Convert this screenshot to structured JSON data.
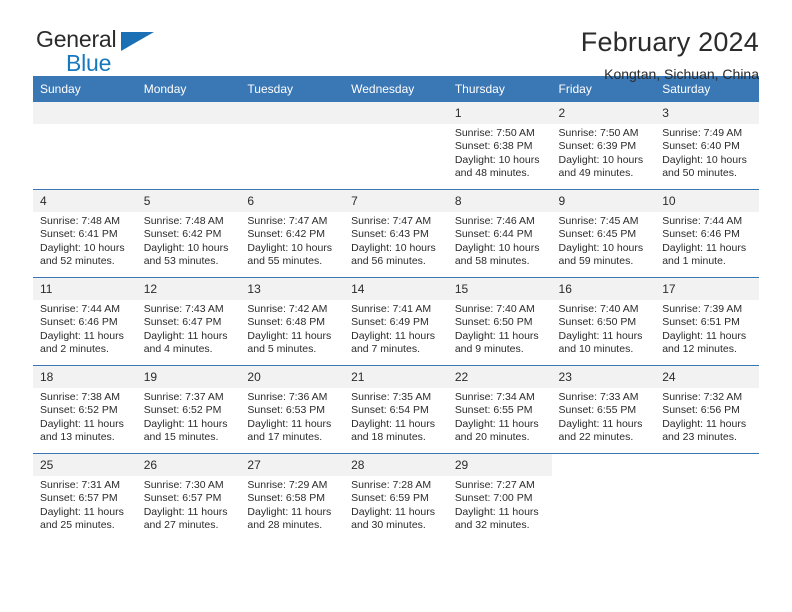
{
  "brand": {
    "name_part1": "General",
    "name_part2": "Blue",
    "accent_color": "#1a6fb5"
  },
  "header": {
    "title": "February 2024",
    "location": "Kongtan, Sichuan, China"
  },
  "calendar": {
    "header_color": "#3a77b5",
    "daynum_band_color": "#f2f2f2",
    "weekday_names": [
      "Sunday",
      "Monday",
      "Tuesday",
      "Wednesday",
      "Thursday",
      "Friday",
      "Saturday"
    ],
    "weeks": [
      [
        {
          "day": "",
          "sunrise": "",
          "sunset": "",
          "daylight_1": "",
          "daylight_2": ""
        },
        {
          "day": "",
          "sunrise": "",
          "sunset": "",
          "daylight_1": "",
          "daylight_2": ""
        },
        {
          "day": "",
          "sunrise": "",
          "sunset": "",
          "daylight_1": "",
          "daylight_2": ""
        },
        {
          "day": "",
          "sunrise": "",
          "sunset": "",
          "daylight_1": "",
          "daylight_2": ""
        },
        {
          "day": "1",
          "sunrise": "Sunrise: 7:50 AM",
          "sunset": "Sunset: 6:38 PM",
          "daylight_1": "Daylight: 10 hours",
          "daylight_2": "and 48 minutes."
        },
        {
          "day": "2",
          "sunrise": "Sunrise: 7:50 AM",
          "sunset": "Sunset: 6:39 PM",
          "daylight_1": "Daylight: 10 hours",
          "daylight_2": "and 49 minutes."
        },
        {
          "day": "3",
          "sunrise": "Sunrise: 7:49 AM",
          "sunset": "Sunset: 6:40 PM",
          "daylight_1": "Daylight: 10 hours",
          "daylight_2": "and 50 minutes."
        }
      ],
      [
        {
          "day": "4",
          "sunrise": "Sunrise: 7:48 AM",
          "sunset": "Sunset: 6:41 PM",
          "daylight_1": "Daylight: 10 hours",
          "daylight_2": "and 52 minutes."
        },
        {
          "day": "5",
          "sunrise": "Sunrise: 7:48 AM",
          "sunset": "Sunset: 6:42 PM",
          "daylight_1": "Daylight: 10 hours",
          "daylight_2": "and 53 minutes."
        },
        {
          "day": "6",
          "sunrise": "Sunrise: 7:47 AM",
          "sunset": "Sunset: 6:42 PM",
          "daylight_1": "Daylight: 10 hours",
          "daylight_2": "and 55 minutes."
        },
        {
          "day": "7",
          "sunrise": "Sunrise: 7:47 AM",
          "sunset": "Sunset: 6:43 PM",
          "daylight_1": "Daylight: 10 hours",
          "daylight_2": "and 56 minutes."
        },
        {
          "day": "8",
          "sunrise": "Sunrise: 7:46 AM",
          "sunset": "Sunset: 6:44 PM",
          "daylight_1": "Daylight: 10 hours",
          "daylight_2": "and 58 minutes."
        },
        {
          "day": "9",
          "sunrise": "Sunrise: 7:45 AM",
          "sunset": "Sunset: 6:45 PM",
          "daylight_1": "Daylight: 10 hours",
          "daylight_2": "and 59 minutes."
        },
        {
          "day": "10",
          "sunrise": "Sunrise: 7:44 AM",
          "sunset": "Sunset: 6:46 PM",
          "daylight_1": "Daylight: 11 hours",
          "daylight_2": "and 1 minute."
        }
      ],
      [
        {
          "day": "11",
          "sunrise": "Sunrise: 7:44 AM",
          "sunset": "Sunset: 6:46 PM",
          "daylight_1": "Daylight: 11 hours",
          "daylight_2": "and 2 minutes."
        },
        {
          "day": "12",
          "sunrise": "Sunrise: 7:43 AM",
          "sunset": "Sunset: 6:47 PM",
          "daylight_1": "Daylight: 11 hours",
          "daylight_2": "and 4 minutes."
        },
        {
          "day": "13",
          "sunrise": "Sunrise: 7:42 AM",
          "sunset": "Sunset: 6:48 PM",
          "daylight_1": "Daylight: 11 hours",
          "daylight_2": "and 5 minutes."
        },
        {
          "day": "14",
          "sunrise": "Sunrise: 7:41 AM",
          "sunset": "Sunset: 6:49 PM",
          "daylight_1": "Daylight: 11 hours",
          "daylight_2": "and 7 minutes."
        },
        {
          "day": "15",
          "sunrise": "Sunrise: 7:40 AM",
          "sunset": "Sunset: 6:50 PM",
          "daylight_1": "Daylight: 11 hours",
          "daylight_2": "and 9 minutes."
        },
        {
          "day": "16",
          "sunrise": "Sunrise: 7:40 AM",
          "sunset": "Sunset: 6:50 PM",
          "daylight_1": "Daylight: 11 hours",
          "daylight_2": "and 10 minutes."
        },
        {
          "day": "17",
          "sunrise": "Sunrise: 7:39 AM",
          "sunset": "Sunset: 6:51 PM",
          "daylight_1": "Daylight: 11 hours",
          "daylight_2": "and 12 minutes."
        }
      ],
      [
        {
          "day": "18",
          "sunrise": "Sunrise: 7:38 AM",
          "sunset": "Sunset: 6:52 PM",
          "daylight_1": "Daylight: 11 hours",
          "daylight_2": "and 13 minutes."
        },
        {
          "day": "19",
          "sunrise": "Sunrise: 7:37 AM",
          "sunset": "Sunset: 6:52 PM",
          "daylight_1": "Daylight: 11 hours",
          "daylight_2": "and 15 minutes."
        },
        {
          "day": "20",
          "sunrise": "Sunrise: 7:36 AM",
          "sunset": "Sunset: 6:53 PM",
          "daylight_1": "Daylight: 11 hours",
          "daylight_2": "and 17 minutes."
        },
        {
          "day": "21",
          "sunrise": "Sunrise: 7:35 AM",
          "sunset": "Sunset: 6:54 PM",
          "daylight_1": "Daylight: 11 hours",
          "daylight_2": "and 18 minutes."
        },
        {
          "day": "22",
          "sunrise": "Sunrise: 7:34 AM",
          "sunset": "Sunset: 6:55 PM",
          "daylight_1": "Daylight: 11 hours",
          "daylight_2": "and 20 minutes."
        },
        {
          "day": "23",
          "sunrise": "Sunrise: 7:33 AM",
          "sunset": "Sunset: 6:55 PM",
          "daylight_1": "Daylight: 11 hours",
          "daylight_2": "and 22 minutes."
        },
        {
          "day": "24",
          "sunrise": "Sunrise: 7:32 AM",
          "sunset": "Sunset: 6:56 PM",
          "daylight_1": "Daylight: 11 hours",
          "daylight_2": "and 23 minutes."
        }
      ],
      [
        {
          "day": "25",
          "sunrise": "Sunrise: 7:31 AM",
          "sunset": "Sunset: 6:57 PM",
          "daylight_1": "Daylight: 11 hours",
          "daylight_2": "and 25 minutes."
        },
        {
          "day": "26",
          "sunrise": "Sunrise: 7:30 AM",
          "sunset": "Sunset: 6:57 PM",
          "daylight_1": "Daylight: 11 hours",
          "daylight_2": "and 27 minutes."
        },
        {
          "day": "27",
          "sunrise": "Sunrise: 7:29 AM",
          "sunset": "Sunset: 6:58 PM",
          "daylight_1": "Daylight: 11 hours",
          "daylight_2": "and 28 minutes."
        },
        {
          "day": "28",
          "sunrise": "Sunrise: 7:28 AM",
          "sunset": "Sunset: 6:59 PM",
          "daylight_1": "Daylight: 11 hours",
          "daylight_2": "and 30 minutes."
        },
        {
          "day": "29",
          "sunrise": "Sunrise: 7:27 AM",
          "sunset": "Sunset: 7:00 PM",
          "daylight_1": "Daylight: 11 hours",
          "daylight_2": "and 32 minutes."
        },
        {
          "day": "",
          "sunrise": "",
          "sunset": "",
          "daylight_1": "",
          "daylight_2": ""
        },
        {
          "day": "",
          "sunrise": "",
          "sunset": "",
          "daylight_1": "",
          "daylight_2": ""
        }
      ]
    ]
  }
}
